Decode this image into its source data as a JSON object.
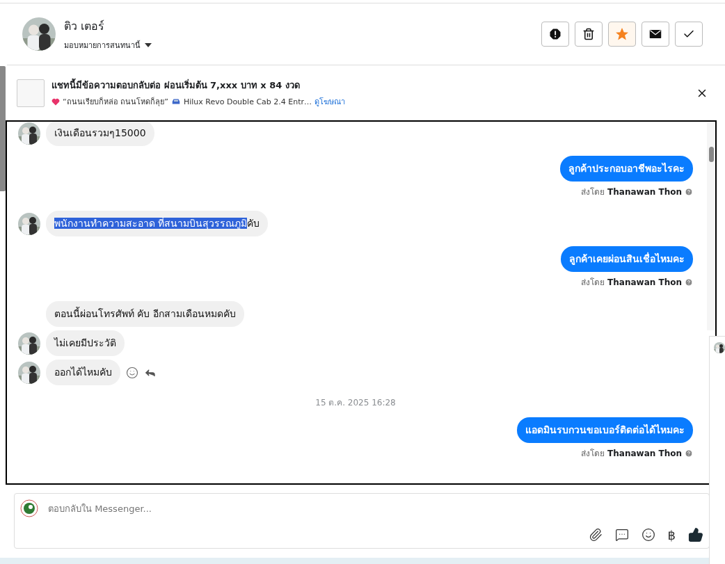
{
  "contact": {
    "name": "ติว เตอร์",
    "assign_label": "มอบหมายการสนทนานี้"
  },
  "actions": [
    {
      "kind": "spam",
      "active": false
    },
    {
      "kind": "delete",
      "active": false
    },
    {
      "kind": "star",
      "active": true
    },
    {
      "kind": "unread",
      "active": false
    },
    {
      "kind": "done",
      "active": false
    }
  ],
  "ad": {
    "title": "แชทนี้มีข้อความตอบกลับต่อ ผ่อนเริ่มต้น 7,xxx บาท x 84 งวด",
    "slogan": "“ถนนเรียบก็หล่อ ถนนโหดก็ลุย”",
    "product": "Hilux Revo Double Cab 2.4 Entr…",
    "link": "ดูโฆษณา"
  },
  "messages": [
    {
      "kind": "incoming",
      "avatar": true,
      "parts": [
        {
          "text": "เงินเดือนรวมๆ15000",
          "selected": false
        }
      ]
    },
    {
      "kind": "outgoing",
      "text": "ลูกค้าประกอบอาชีพอะไรคะ",
      "sent_by_label": "ส่งโดย",
      "sender": "Thanawan Thon"
    },
    {
      "kind": "incoming",
      "avatar": true,
      "parts": [
        {
          "text": "พนักงานทำความสะอาด ที่สนามบินสุวรรณภูมิ",
          "selected": true
        },
        {
          "text": "คับ",
          "selected": false
        }
      ]
    },
    {
      "kind": "outgoing",
      "text": "ลูกค้าเคยผ่อนสินเชื่อไหมคะ",
      "sent_by_label": "ส่งโดย",
      "sender": "Thanawan Thon"
    },
    {
      "kind": "incoming",
      "avatar": false,
      "parts": [
        {
          "text": "ตอนนี้ผ่อนโทรศัพท์ คับ อีกสามเดือนหมดคับ",
          "selected": false
        }
      ]
    },
    {
      "kind": "incoming",
      "avatar": true,
      "parts": [
        {
          "text": "ไม่เคยมีประวัติ",
          "selected": false
        }
      ]
    },
    {
      "kind": "incoming",
      "avatar": true,
      "hover_actions": true,
      "parts": [
        {
          "text": "ออกได้ไหมคับ",
          "selected": false
        }
      ]
    },
    {
      "kind": "timestamp",
      "text": "15 ต.ค. 2025 16:28"
    },
    {
      "kind": "outgoing",
      "text": "แอดมินรบกวนขอเบอร์ติดต่อได้ไหมคะ",
      "sent_by_label": "ส่งโดย",
      "sender": "Thanawan Thon"
    }
  ],
  "composer": {
    "placeholder": "ตอบกลับใน Messenger...",
    "currency_symbol": "฿"
  }
}
